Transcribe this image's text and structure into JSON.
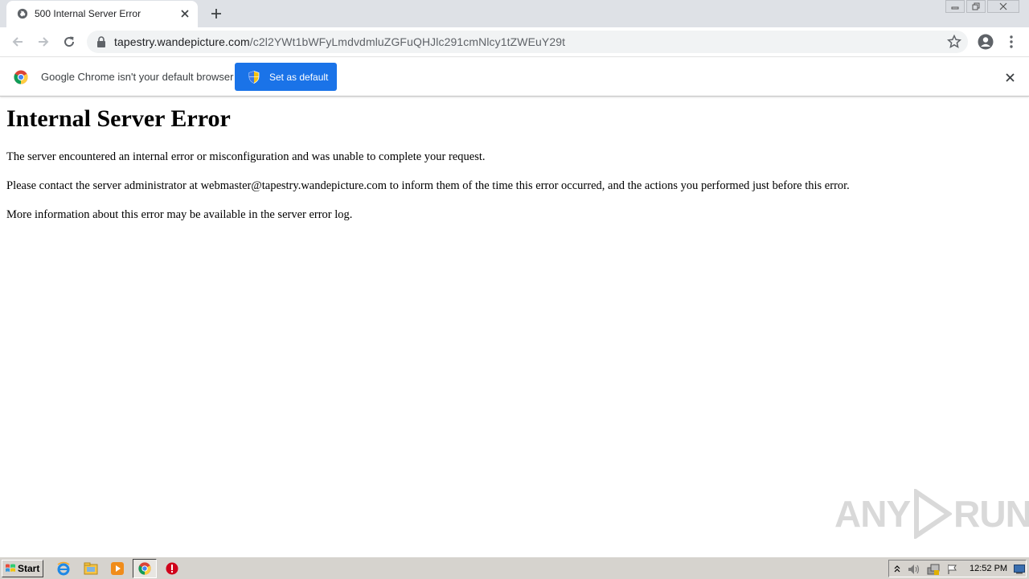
{
  "browser": {
    "tab": {
      "title": "500 Internal Server Error"
    },
    "address_bar": {
      "host": "tapestry.wandepicture.com",
      "path": "/c2l2YWt1bWFyLmdvdmluZGFuQHJlc291cmNlcy1tZWEuY29t"
    },
    "infobar": {
      "message": "Google Chrome isn't your default browser",
      "button_label": "Set as default"
    }
  },
  "page": {
    "title": "Internal Server Error",
    "paragraphs": [
      "The server encountered an internal error or misconfiguration and was unable to complete your request.",
      "Please contact the server administrator at webmaster@tapestry.wandepicture.com to inform them of the time this error occurred, and the actions you performed just before this error.",
      "More information about this error may be available in the server error log."
    ]
  },
  "watermark": {
    "left": "ANY",
    "right": "RUN"
  },
  "taskbar": {
    "start_label": "Start",
    "apps": [
      "ie-icon",
      "explorer-icon",
      "media-player-icon",
      "chrome-icon",
      "stop-icon"
    ],
    "clock": "12:52 PM"
  },
  "colors": {
    "tabstrip": "#dee1e6",
    "accent_blue": "#1a73e8",
    "taskbar": "#d6d3ce"
  }
}
